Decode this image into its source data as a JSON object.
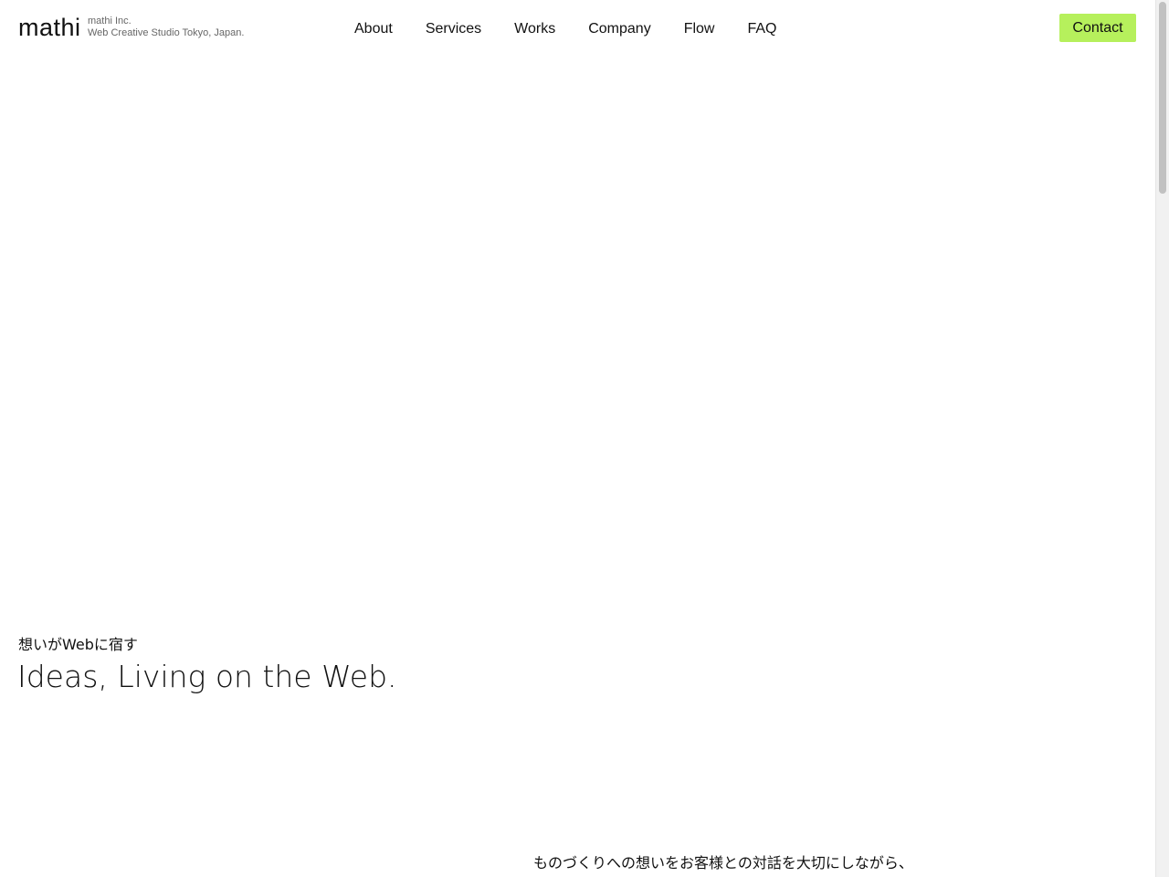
{
  "header": {
    "logo_text": "mathi",
    "company_name": "mathi Inc.",
    "company_desc": "Web Creative Studio Tokyo, Japan.",
    "nav": [
      {
        "label": "About"
      },
      {
        "label": "Services"
      },
      {
        "label": "Works"
      },
      {
        "label": "Company"
      },
      {
        "label": "Flow"
      },
      {
        "label": "FAQ"
      }
    ],
    "contact_label": "Contact"
  },
  "hero": {
    "tagline_jp": "想いがWebに宿す",
    "tagline_en": "Ideas, Living on the Web."
  },
  "intro": {
    "line1": "ものづくりへの想いをお客様との対話を大切にしながら、"
  },
  "colors": {
    "accent": "#b6f05c",
    "text": "#111111",
    "subtext": "#666666",
    "background": "#ffffff"
  }
}
